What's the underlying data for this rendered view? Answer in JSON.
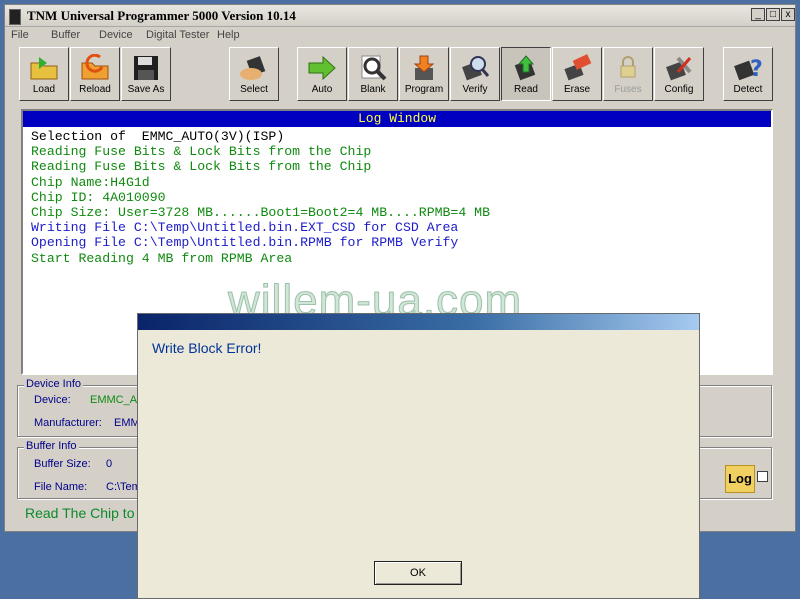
{
  "window": {
    "title": "TNM  Universal Programmer 5000   Version 10.14",
    "min": "_",
    "max": "□",
    "close": "x"
  },
  "menu": [
    "File",
    "Buffer",
    "Device",
    "Digital Tester",
    "Help"
  ],
  "toolbar": [
    {
      "label": "Load",
      "icon": "folder-icon"
    },
    {
      "label": "Reload",
      "icon": "reload-icon"
    },
    {
      "label": "Save As",
      "icon": "floppy-icon"
    },
    {
      "label": "Select",
      "icon": "chip-hand-icon"
    },
    {
      "label": "Auto",
      "icon": "arrow-right-icon"
    },
    {
      "label": "Blank",
      "icon": "magnifier-icon"
    },
    {
      "label": "Program",
      "icon": "program-icon"
    },
    {
      "label": "Verify",
      "icon": "verify-icon"
    },
    {
      "label": "Read",
      "icon": "read-chip-icon"
    },
    {
      "label": "Erase",
      "icon": "eraser-icon"
    },
    {
      "label": "Fuses",
      "icon": "lock-icon"
    },
    {
      "label": "Config",
      "icon": "tools-icon"
    },
    {
      "label": "Detect",
      "icon": "question-chip-icon"
    }
  ],
  "log": {
    "title": "Log Window",
    "lines": [
      {
        "text": "Selection of  EMMC_AUTO(3V)(ISP)",
        "color": "#000000"
      },
      {
        "text": "Reading Fuse Bits & Lock Bits from the Chip",
        "color": "#108a10"
      },
      {
        "text": "Reading Fuse Bits & Lock Bits from the Chip",
        "color": "#108a10"
      },
      {
        "text": "Chip Name:H4G1d",
        "color": "#108a10"
      },
      {
        "text": "Chip ID: 4A010090",
        "color": "#108a10"
      },
      {
        "text": "Chip Size: User=3728 MB......Boot1=Boot2=4 MB....RPMB=4 MB",
        "color": "#108a10"
      },
      {
        "text": "Writing File C:\\Temp\\Untitled.bin.EXT_CSD for CSD Area",
        "color": "#1c1cc8"
      },
      {
        "text": "Opening File C:\\Temp\\Untitled.bin.RPMB for RPMB Verify",
        "color": "#1c1cc8"
      },
      {
        "text": "Start Reading 4 MB from RPMB Area",
        "color": "#108a10"
      }
    ]
  },
  "device_info": {
    "title": "Device Info",
    "device_label": "Device:",
    "device_value": "EMMC_AU",
    "manufacturer_label": "Manufacturer:",
    "manufacturer_value": "EMMC"
  },
  "buffer_info": {
    "title": "Buffer Info",
    "size_label": "Buffer Size:",
    "size_value": "0",
    "file_label": "File Name:",
    "file_value": "C:\\Tem"
  },
  "status": "Read The Chip to B",
  "log_button": "Log",
  "watermark": "willem-ua.com",
  "dialog": {
    "message": "Write Block Error!",
    "ok": "OK"
  }
}
